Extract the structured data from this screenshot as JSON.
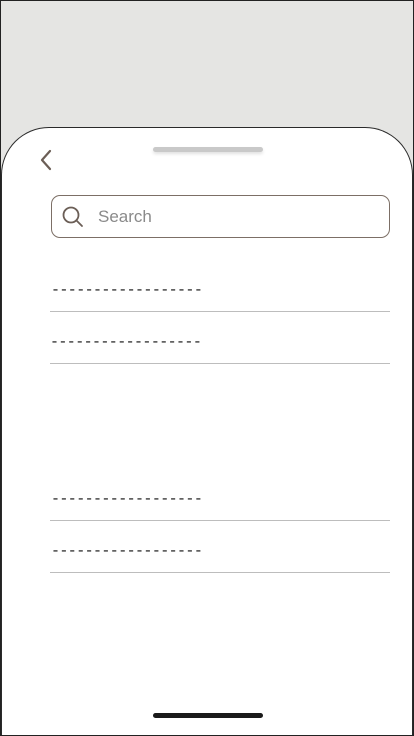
{
  "search": {
    "placeholder": "Search",
    "value": ""
  },
  "list_group_1": [
    {
      "label": "------------------"
    },
    {
      "label": "------------------"
    }
  ],
  "list_group_2": [
    {
      "label": "------------------"
    },
    {
      "label": "------------------"
    }
  ],
  "icons": {
    "back": "chevron-left-icon",
    "search": "search-icon"
  },
  "colors": {
    "background": "#e5e5e3",
    "sheet": "#ffffff",
    "accent": "#7c6f66",
    "divider": "#bdbdbd"
  }
}
